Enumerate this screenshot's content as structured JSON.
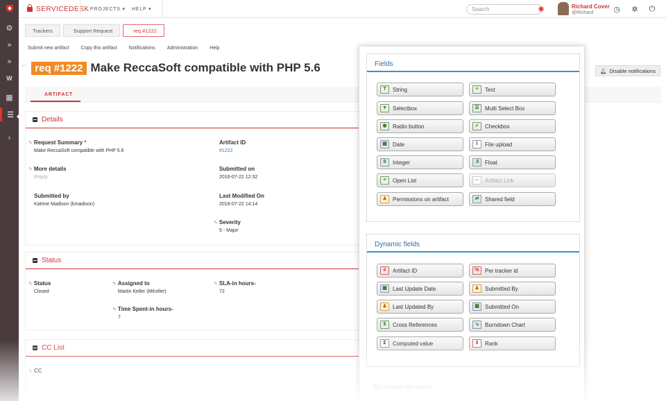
{
  "app": {
    "brand": "SERVICEDESK",
    "menu_projects": "PROJECTS ▾",
    "menu_help": "HELP ▾",
    "search_placeholder": "Search",
    "user_name": "Richard Cover",
    "user_handle": "@Richard"
  },
  "breadcrumb": [
    "Trackers",
    "Support Request",
    "req #1222"
  ],
  "actions": [
    "Submit new artifact",
    "Copy this artifact",
    "Notifications",
    "Administration",
    "Help"
  ],
  "artifact": {
    "id_badge": "req #1222",
    "title": "Make ReccaSoft compatible with PHP 5.6",
    "tab": "ARTIFACT",
    "disable_notifications": "Disable notifications"
  },
  "details": {
    "title": "Details",
    "request_summary_label": "Request Summary",
    "request_summary_value": "Make ReccaSoft compatible with PHP 5.6",
    "more_details_label": "More details",
    "more_details_value": "Empty",
    "submitted_by_label": "Submitted by",
    "submitted_by_value": "Katrine Madison (kmadison)",
    "artifact_id_label": "Artifact ID",
    "artifact_id_value": "#1222",
    "submitted_on_label": "Submitted on",
    "submitted_on_value": "2016-07-22 12:32",
    "last_modified_label": "Last Modified On",
    "last_modified_value": "2016-07-22 14:14",
    "severity_label": "Severity",
    "severity_value": "5 - Major"
  },
  "status": {
    "title": "Status",
    "status_label": "Status",
    "status_value": "Closed",
    "assigned_label": "Assigned to",
    "assigned_value": "Martin Keller (MKeller)",
    "sla_label": "SLA-in hours-",
    "sla_value": "72",
    "time_spent_label": "Time Spent-in hours-",
    "time_spent_value": "7"
  },
  "cclist": {
    "title": "CC List",
    "cc_label": "CC"
  },
  "panel": {
    "fields_title": "Fields",
    "fields": [
      {
        "label": "String",
        "icon": "string-icon"
      },
      {
        "label": "Text",
        "icon": "text-icon"
      },
      {
        "label": "Selectbox",
        "icon": "selectbox-icon"
      },
      {
        "label": "Multi Select Box",
        "icon": "multiselect-icon"
      },
      {
        "label": "Radio button",
        "icon": "radio-icon"
      },
      {
        "label": "Checkbox",
        "icon": "checkbox-icon"
      },
      {
        "label": "Date",
        "icon": "date-icon"
      },
      {
        "label": "File upload",
        "icon": "file-upload-icon"
      },
      {
        "label": "Integer",
        "icon": "integer-icon"
      },
      {
        "label": "Float",
        "icon": "float-icon"
      },
      {
        "label": "Open List",
        "icon": "open-list-icon"
      },
      {
        "label": "Artifact Link",
        "icon": "artifact-link-icon"
      },
      {
        "label": "Permissions on artifact",
        "icon": "permissions-icon"
      },
      {
        "label": "Shared field",
        "icon": "shared-field-icon"
      }
    ],
    "dynamic_title": "Dynamic fields",
    "dynamic": [
      {
        "label": "Artifact ID",
        "icon": "artifact-id-icon"
      },
      {
        "label": "Per tracker id",
        "icon": "per-tracker-id-icon"
      },
      {
        "label": "Last Update Date",
        "icon": "last-update-date-icon"
      },
      {
        "label": "Submitted By",
        "icon": "submitted-by-icon"
      },
      {
        "label": "Last Updated By",
        "icon": "last-updated-by-icon"
      },
      {
        "label": "Submitted On",
        "icon": "submitted-on-icon"
      },
      {
        "label": "Cross References",
        "icon": "cross-references-icon"
      },
      {
        "label": "Burndown Chart",
        "icon": "burndown-chart-icon"
      },
      {
        "label": "Computed value",
        "icon": "computed-value-icon"
      },
      {
        "label": "Rank",
        "icon": "rank-icon"
      }
    ],
    "structural_title": "Structural elements"
  },
  "colors": {
    "brand": "#cc3333",
    "accent_blue": "#2a6fb0",
    "badge_orange": "#f08a24",
    "sidebar": "#4a3b3d"
  }
}
